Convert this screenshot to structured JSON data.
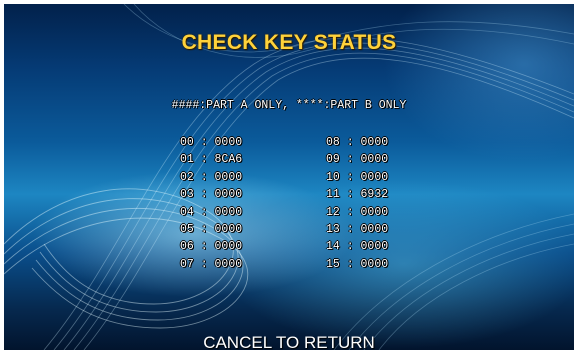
{
  "title": "CHECK KEY STATUS",
  "legend": "####:PART A ONLY, ****:PART B ONLY",
  "left_column": [
    {
      "index": "00",
      "value": "0000"
    },
    {
      "index": "01",
      "value": "8CA6"
    },
    {
      "index": "02",
      "value": "0000"
    },
    {
      "index": "03",
      "value": "0000"
    },
    {
      "index": "04",
      "value": "0000"
    },
    {
      "index": "05",
      "value": "0000"
    },
    {
      "index": "06",
      "value": "0000"
    },
    {
      "index": "07",
      "value": "0000"
    }
  ],
  "right_column": [
    {
      "index": "08",
      "value": "0000"
    },
    {
      "index": "09",
      "value": "0000"
    },
    {
      "index": "10",
      "value": "0000"
    },
    {
      "index": "11",
      "value": "6932"
    },
    {
      "index": "12",
      "value": "0000"
    },
    {
      "index": "13",
      "value": "0000"
    },
    {
      "index": "14",
      "value": "0000"
    },
    {
      "index": "15",
      "value": "0000"
    }
  ],
  "separator": " : ",
  "footer": "CANCEL TO RETURN",
  "colors": {
    "title": "#ffd23a",
    "text": "#ffffff",
    "background_dark": "#02214b",
    "background_light": "#1d86c2"
  }
}
